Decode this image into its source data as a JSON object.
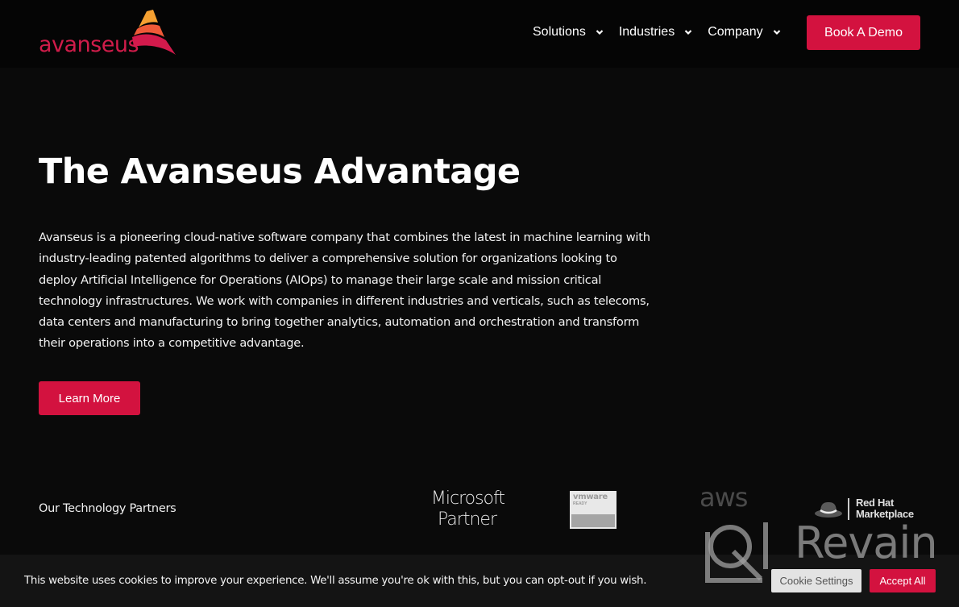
{
  "header": {
    "logo_text": "avanseus",
    "nav": [
      {
        "label": "Solutions",
        "icon": "chevron-down-icon"
      },
      {
        "label": "Industries",
        "icon": "chevron-down-icon"
      },
      {
        "label": "Company",
        "icon": "chevron-down-icon"
      }
    ],
    "cta_label": "Book A Demo"
  },
  "hero": {
    "title": "The Avanseus Advantage",
    "description": "Avanseus is a pioneering cloud-native software company that combines the latest in machine learning with industry-leading patented algorithms to deliver a comprehensive solution for organizations looking to deploy Artificial Intelligence for Operations (AIOps) to manage their large scale and mission critical technology infrastructures. We work with companies in different industries and verticals, such as telecoms, data centers and manufacturing to bring together analytics, automation and orchestration and transform their operations into a competitive advantage.",
    "button_label": "Learn More"
  },
  "partners": {
    "label": "Our Technology Partners",
    "logos": {
      "microsoft_line1": "Microsoft",
      "microsoft_line2": "Partner",
      "vmware_top": "vmware",
      "vmware_ready": "READY",
      "aws": "aws",
      "redhat_line1": "Red Hat",
      "redhat_line2": "Marketplace"
    }
  },
  "cookie": {
    "message": "This website uses cookies to improve your experience. We'll assume you're ok with this, but you can opt-out if you wish.",
    "settings_label": "Cookie Settings",
    "accept_label": "Accept All"
  },
  "watermark": {
    "text": "Revain"
  },
  "colors": {
    "accent": "#d3123f",
    "background": "#0a0a0a",
    "logo_red": "#d01c4a",
    "logo_orange": "#f5a031"
  }
}
